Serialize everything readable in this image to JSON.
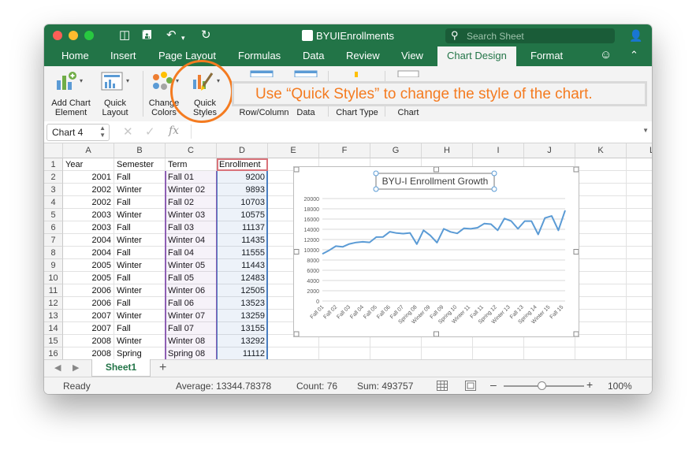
{
  "window": {
    "title": "BYUIEnrollments",
    "search_placeholder": "Search Sheet"
  },
  "tabs": [
    "Home",
    "Insert",
    "Page Layout",
    "Formulas",
    "Data",
    "Review",
    "View",
    "Chart Design",
    "Format"
  ],
  "active_tab": "Chart Design",
  "ribbon": {
    "add_chart_element": [
      "Add Chart",
      "Element"
    ],
    "quick_layout": [
      "Quick",
      "Layout"
    ],
    "change_colors": [
      "Change",
      "Colors"
    ],
    "quick_styles": [
      "Quick",
      "Styles"
    ],
    "row_column": "Row/Column",
    "data": "Data",
    "chart_type": "Chart Type",
    "chart": "Chart"
  },
  "callout": "Use “Quick Styles” to change the style of the chart.",
  "formula_bar": {
    "name_box": "Chart 4",
    "fx": "fx"
  },
  "columns": [
    "A",
    "B",
    "C",
    "D",
    "E",
    "F",
    "G",
    "H",
    "I",
    "J",
    "K",
    "L"
  ],
  "rows": [
    [
      "1",
      "Year",
      "Semester",
      "Term",
      "Enrollment"
    ],
    [
      "2",
      "2001",
      "Fall",
      "Fall 01",
      "9200"
    ],
    [
      "3",
      "2002",
      "Winter",
      "Winter 02",
      "9893"
    ],
    [
      "4",
      "2002",
      "Fall",
      "Fall 02",
      "10703"
    ],
    [
      "5",
      "2003",
      "Winter",
      "Winter 03",
      "10575"
    ],
    [
      "6",
      "2003",
      "Fall",
      "Fall 03",
      "11137"
    ],
    [
      "7",
      "2004",
      "Winter",
      "Winter 04",
      "11435"
    ],
    [
      "8",
      "2004",
      "Fall",
      "Fall 04",
      "11555"
    ],
    [
      "9",
      "2005",
      "Winter",
      "Winter 05",
      "11443"
    ],
    [
      "10",
      "2005",
      "Fall",
      "Fall 05",
      "12483"
    ],
    [
      "11",
      "2006",
      "Winter",
      "Winter 06",
      "12505"
    ],
    [
      "12",
      "2006",
      "Fall",
      "Fall 06",
      "13523"
    ],
    [
      "13",
      "2007",
      "Winter",
      "Winter 07",
      "13259"
    ],
    [
      "14",
      "2007",
      "Fall",
      "Fall 07",
      "13155"
    ],
    [
      "15",
      "2008",
      "Winter",
      "Winter 08",
      "13292"
    ],
    [
      "16",
      "2008",
      "Spring",
      "Spring 08",
      "11112"
    ]
  ],
  "sheet_tab": "Sheet1",
  "status": {
    "ready": "Ready",
    "average": "Average: 13344.78378",
    "count": "Count: 76",
    "sum": "Sum: 493757",
    "zoom": "100%"
  },
  "colors": {
    "excel_green": "#227447",
    "accent_orange": "#f47b20",
    "series_blue": "#5b9bd5"
  },
  "chart_data": {
    "type": "line",
    "title": "BYU-I Enrollment Growth",
    "xlabel": "",
    "ylabel": "",
    "ylim": [
      0,
      20000
    ],
    "yticks": [
      "0",
      "2000",
      "4000",
      "6000",
      "8000",
      "10000",
      "12000",
      "14000",
      "16000",
      "18000",
      "20000"
    ],
    "x_tick_labels": [
      "Fall 01",
      "Fall 02",
      "Fall 03",
      "Fall 04",
      "Fall 05",
      "Fall 06",
      "Fall 07",
      "Spring 08",
      "Winter 09",
      "Fall 09",
      "Spring 10",
      "Winter 11",
      "Fall 11",
      "Spring 12",
      "Winter 13",
      "Fall 13",
      "Spring 14",
      "Winter 15",
      "Fall 15"
    ],
    "grid": true,
    "legend": "none",
    "series": [
      {
        "values": [
          9200,
          9893,
          10703,
          10575,
          11137,
          11435,
          11555,
          11443,
          12483,
          12505,
          13523,
          13259,
          13155,
          13292,
          11112,
          13800,
          12800,
          11400,
          14100,
          13500,
          13200,
          14200,
          14100,
          14300,
          15100,
          15000,
          13800,
          16100,
          15600,
          14100,
          15600,
          15600,
          13000,
          16200,
          16600,
          13800,
          17700
        ]
      }
    ]
  }
}
